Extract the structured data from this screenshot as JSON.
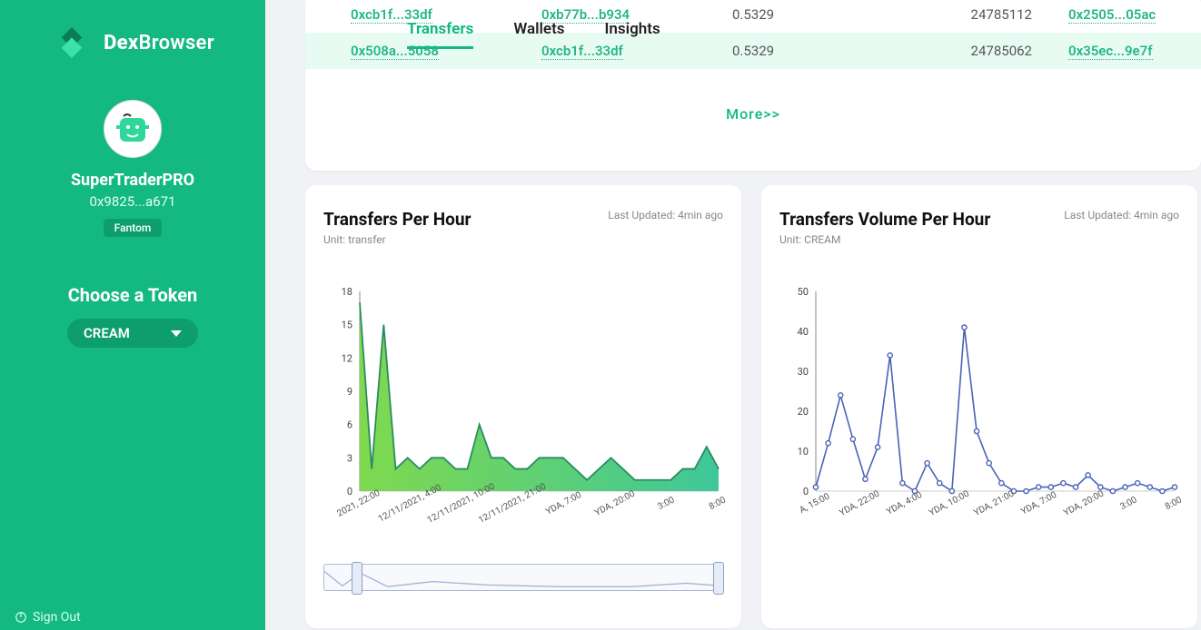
{
  "brand": {
    "prefix": "Dex",
    "suffix": "Browser"
  },
  "user": {
    "name": "SuperTraderPRO",
    "address": "0x9825...a671",
    "chain": "Fantom"
  },
  "choose_label": "Choose a Token",
  "token_selected": "CREAM",
  "signout_label": "Sign Out",
  "tabs": [
    {
      "label": "Transfers",
      "active": true
    },
    {
      "label": "Wallets",
      "active": false
    },
    {
      "label": "Insights",
      "active": false
    }
  ],
  "table_rows": [
    {
      "from": "0xcb1f...33df",
      "to": "0xb77b...b934",
      "amount": "0.5329",
      "block": "24785112",
      "tx": "0x2505...05ac"
    },
    {
      "from": "0x508a...5058",
      "to": "0xcb1f...33df",
      "amount": "0.5329",
      "block": "24785062",
      "tx": "0x35ec...9e7f"
    }
  ],
  "more_label": "More>>",
  "charts": {
    "left": {
      "title": "Transfers Per Hour",
      "updated": "Last Updated: 4min ago",
      "unit": "Unit: transfer"
    },
    "right": {
      "title": "Transfers Volume Per Hour",
      "updated": "Last Updated: 4min ago",
      "unit": "Unit: CREAM"
    }
  },
  "chart_data": [
    {
      "type": "area",
      "title": "Transfers Per Hour",
      "xlabel": "",
      "ylabel": "",
      "ylim": [
        0,
        18
      ],
      "categories": [
        "2021, 22:00",
        "12/11/2021, 4:00",
        "12/11/2021, 10:00",
        "12/11/2021, 21:00",
        "YDA, 7:00",
        "YDA, 20:00",
        "3:00",
        "8:00"
      ],
      "x_ticks": [
        "2021, 22:00",
        "12/11/2021, 4:00",
        "12/11/2021, 10:00",
        "12/11/2021, 21:00",
        "YDA, 7:00",
        "YDA, 20:00",
        "3:00",
        "8:00"
      ],
      "values": [
        17,
        2,
        15,
        2,
        3,
        2,
        3,
        3,
        2,
        2,
        6,
        3,
        3,
        2,
        2,
        3,
        3,
        3,
        2,
        1,
        2,
        3,
        2,
        1,
        1,
        1,
        1,
        2,
        2,
        4,
        2
      ]
    },
    {
      "type": "line",
      "title": "Transfers Volume Per Hour",
      "xlabel": "",
      "ylabel": "",
      "ylim": [
        0,
        50
      ],
      "categories": [
        "A, 15:00",
        "YDA, 22:00",
        "YDA, 4:00",
        "YDA, 10:00",
        "YDA, 21:00",
        "YDA, 7:00",
        "YDA, 20:00",
        "3:00",
        "8:00"
      ],
      "x_ticks": [
        "A, 15:00",
        "YDA, 22:00",
        "YDA, 4:00",
        "YDA, 10:00",
        "YDA, 21:00",
        "YDA, 7:00",
        "YDA, 20:00",
        "3:00",
        "8:00"
      ],
      "values": [
        1,
        12,
        24,
        13,
        3,
        11,
        34,
        2,
        0,
        7,
        2,
        0,
        41,
        15,
        7,
        2,
        0,
        0,
        1,
        1,
        2,
        1,
        4,
        1,
        0,
        1,
        2,
        1,
        0,
        1
      ]
    }
  ]
}
